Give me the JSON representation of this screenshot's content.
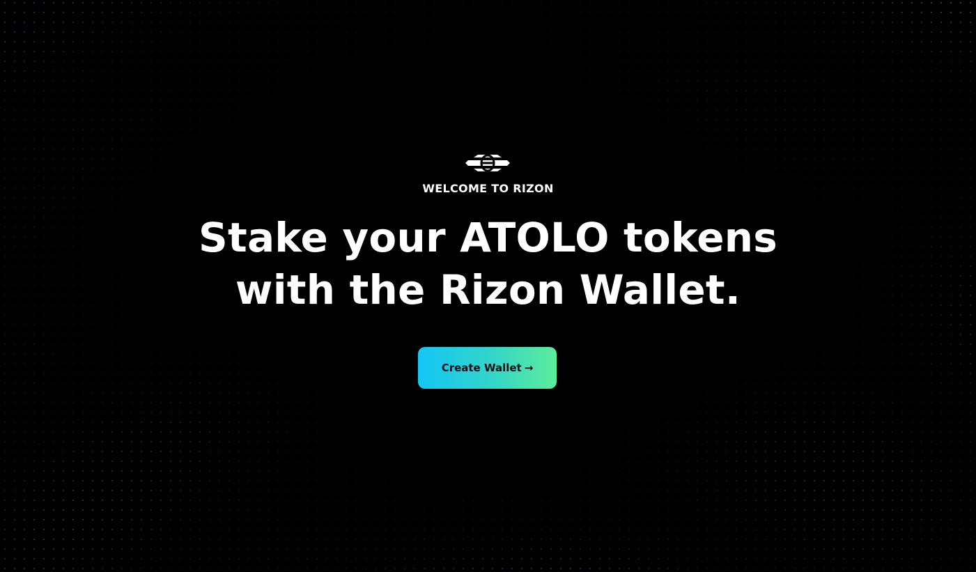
{
  "hero": {
    "eyebrow": "WELCOME TO RIZON",
    "headline_line1": "Stake your ATOLO tokens",
    "headline_line2": "with the Rizon Wallet.",
    "cta_label": "Create Wallet",
    "cta_arrow": "→"
  },
  "icons": {
    "logo": "rizon-logo-icon",
    "cta_arrow": "arrow-right-icon"
  },
  "colors": {
    "background": "#000000",
    "text": "#ffffff",
    "cta_gradient_start": "#14c6f5",
    "cta_gradient_end": "#5cec9a",
    "cta_text": "#0b0d14",
    "dot_blue": "#2a6f9e",
    "dot_green": "#2f7a55"
  }
}
